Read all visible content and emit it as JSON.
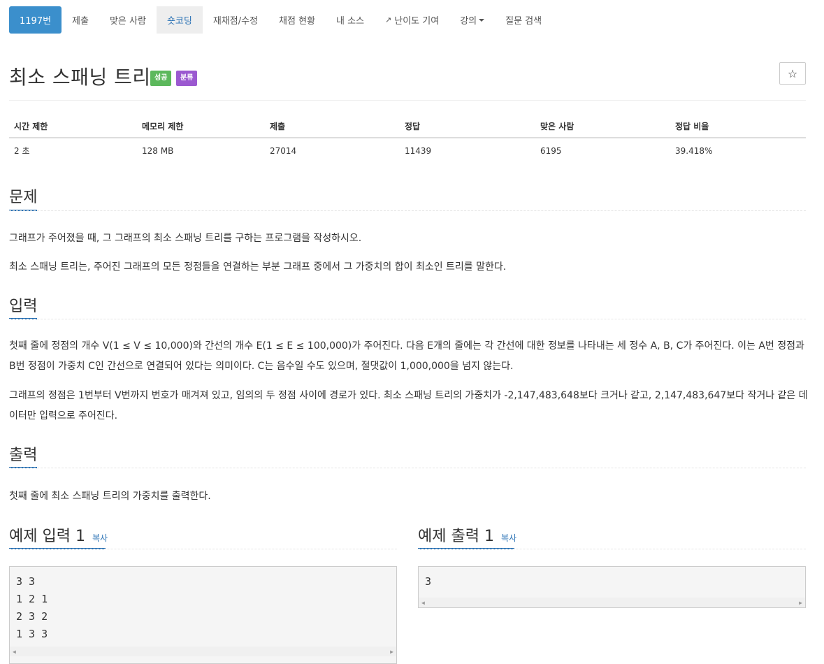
{
  "nav": {
    "items": [
      {
        "label": "1197번",
        "state": "active"
      },
      {
        "label": "제출"
      },
      {
        "label": "맞은 사람"
      },
      {
        "label": "숏코딩",
        "state": "selected"
      },
      {
        "label": "재채점/수정"
      },
      {
        "label": "채점 현황"
      },
      {
        "label": "내 소스"
      },
      {
        "label": "난이도 기여",
        "icon": "external-link-icon"
      },
      {
        "label": "강의",
        "icon": "caret-down-icon"
      },
      {
        "label": "질문 검색"
      }
    ]
  },
  "problem": {
    "title": "최소 스패닝 트리",
    "badge_success": "성공",
    "badge_category": "분류",
    "star_icon": "star-icon"
  },
  "stats": {
    "headers": [
      "시간 제한",
      "메모리 제한",
      "제출",
      "정답",
      "맞은 사람",
      "정답 비율"
    ],
    "values": [
      "2 초",
      "128 MB",
      "27014",
      "11439",
      "6195",
      "39.418%"
    ]
  },
  "sections": {
    "problem_heading": "문제",
    "problem_text": [
      "그래프가 주어졌을 때, 그 그래프의 최소 스패닝 트리를 구하는 프로그램을 작성하시오.",
      "최소 스패닝 트리는, 주어진 그래프의 모든 정점들을 연결하는 부분 그래프 중에서 그 가중치의 합이 최소인 트리를 말한다."
    ],
    "input_heading": "입력",
    "input_text": [
      "첫째 줄에 정점의 개수 V(1 ≤ V ≤ 10,000)와 간선의 개수 E(1 ≤ E ≤ 100,000)가 주어진다. 다음 E개의 줄에는 각 간선에 대한 정보를 나타내는 세 정수 A, B, C가 주어진다. 이는 A번 정점과 B번 정점이 가중치 C인 간선으로 연결되어 있다는 의미이다. C는 음수일 수도 있으며, 절댓값이 1,000,000을 넘지 않는다.",
      "그래프의 정점은 1번부터 V번까지 번호가 매겨져 있고, 임의의 두 정점 사이에 경로가 있다. 최소 스패닝 트리의 가중치가 -2,147,483,648보다 크거나 같고, 2,147,483,647보다 작거나 같은 데이터만 입력으로 주어진다."
    ],
    "output_heading": "출력",
    "output_text": "첫째 줄에 최소 스패닝 트리의 가중치를 출력한다."
  },
  "samples": {
    "input_heading": "예제 입력 1",
    "output_heading": "예제 출력 1",
    "copy_label": "복사",
    "input_lines": [
      "3 3",
      "1 2 1",
      "2 3 2",
      "1 3 3"
    ],
    "output_lines": [
      "3"
    ]
  },
  "colors": {
    "accent": "#3b8fcc",
    "link": "#2a72b5",
    "success": "#5cb85c",
    "category": "#9b59d0"
  }
}
